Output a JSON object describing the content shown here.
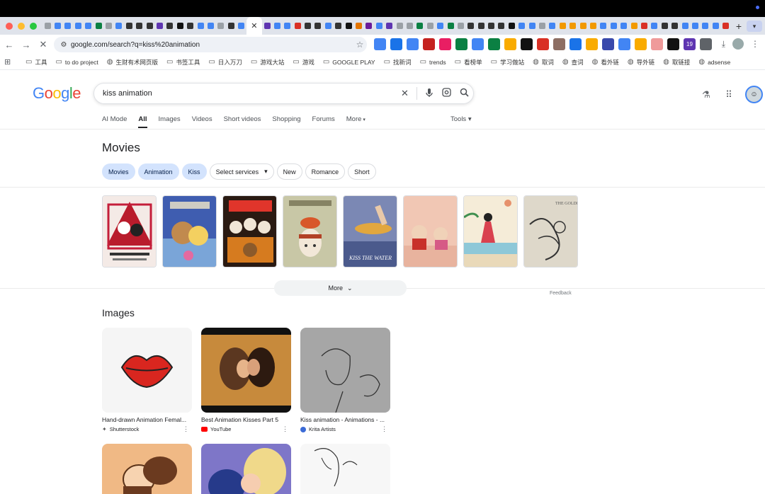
{
  "tabs": {
    "active_tab_close": "✕",
    "new_tab": "+",
    "tab_colors": [
      "#9aa0a6",
      "#4285f4",
      "#4285f4",
      "#4285f4",
      "#4285f4",
      "#0b8043",
      "#9aa0a6",
      "#4285f4",
      "#333",
      "#333",
      "#333",
      "#5e35b1",
      "#333",
      "#111",
      "#333",
      "#4285f4",
      "#4285f4",
      "#9aa0a6",
      "#333",
      "#4285f4",
      "#5e35b1",
      "#4285f4",
      "#4285f4",
      "#d93025",
      "#333",
      "#333",
      "#4285f4",
      "#333",
      "#111",
      "#e37400",
      "#6a1b9a",
      "#4285f4",
      "#5e35b1",
      "#9aa0a6",
      "#9aa0a6",
      "#0b8043",
      "#9aa0a6",
      "#4285f4",
      "#0b8043",
      "#9aa0a6",
      "#333",
      "#333",
      "#333",
      "#333",
      "#111",
      "#4285f4",
      "#4285f4",
      "#9aa0a6",
      "#4285f4",
      "#f29900",
      "#f29900",
      "#f29900",
      "#f29900",
      "#4285f4",
      "#4285f4",
      "#4285f4",
      "#f29900",
      "#d93025",
      "#4285f4",
      "#333",
      "#333",
      "#4285f4",
      "#4285f4",
      "#4285f4",
      "#4285f4",
      "#d93025",
      "#4285f4",
      "#0b8043",
      "#d93025",
      "#9aa0a6",
      "#0b8043"
    ]
  },
  "toolbar": {
    "url": "google.com/search?q=kiss%20animation",
    "ext_badge": "19"
  },
  "bookmarks": [
    {
      "label": "工具",
      "icon": "folder-icon"
    },
    {
      "label": "to do project",
      "icon": "folder-icon"
    },
    {
      "label": "生财有术网页版",
      "icon": "globe-icon"
    },
    {
      "label": "书签工具",
      "icon": "folder-icon"
    },
    {
      "label": "日入万刀",
      "icon": "folder-icon"
    },
    {
      "label": "游戏大站",
      "icon": "folder-icon"
    },
    {
      "label": "游戏",
      "icon": "folder-icon"
    },
    {
      "label": "GOOGLE PLAY",
      "icon": "folder-icon"
    },
    {
      "label": "找新词",
      "icon": "folder-icon"
    },
    {
      "label": "trends",
      "icon": "folder-icon"
    },
    {
      "label": "看榜单",
      "icon": "folder-icon"
    },
    {
      "label": "学习做站",
      "icon": "folder-icon"
    },
    {
      "label": "取词",
      "icon": "globe-icon"
    },
    {
      "label": "查词",
      "icon": "globe-icon"
    },
    {
      "label": "看外链",
      "icon": "globe-icon"
    },
    {
      "label": "导外链",
      "icon": "globe-icon"
    },
    {
      "label": "取链接",
      "icon": "globe-icon"
    },
    {
      "label": "adsense",
      "icon": "globe-icon"
    }
  ],
  "search": {
    "logo": [
      "G",
      "o",
      "o",
      "g",
      "l",
      "e"
    ],
    "logo_colors": [
      "#4285f4",
      "#ea4335",
      "#fbbc05",
      "#4285f4",
      "#34a853",
      "#ea4335"
    ],
    "query": "kiss animation"
  },
  "nav": {
    "items": [
      "AI Mode",
      "All",
      "Images",
      "Videos",
      "Short videos",
      "Shopping",
      "Forums",
      "More"
    ],
    "tools": "Tools"
  },
  "movies": {
    "title": "Movies",
    "chips": [
      {
        "label": "Movies",
        "selected": true
      },
      {
        "label": "Animation",
        "selected": true
      },
      {
        "label": "Kiss",
        "selected": true
      },
      {
        "label": "Select services",
        "selected": false
      },
      {
        "label": "New",
        "selected": false
      },
      {
        "label": "Romance",
        "selected": false
      },
      {
        "label": "Short",
        "selected": false
      }
    ],
    "more_label": "More",
    "feedback": "Feedback"
  },
  "images": {
    "title": "Images",
    "row1": [
      {
        "caption": "Hand-drawn Animation Femal...",
        "source": "Shutterstock"
      },
      {
        "caption": "Best Animation Kisses Part 5",
        "source": "YouTube"
      },
      {
        "caption": "Kiss animation - Animations - ...",
        "source": "Krita Artists"
      }
    ]
  }
}
